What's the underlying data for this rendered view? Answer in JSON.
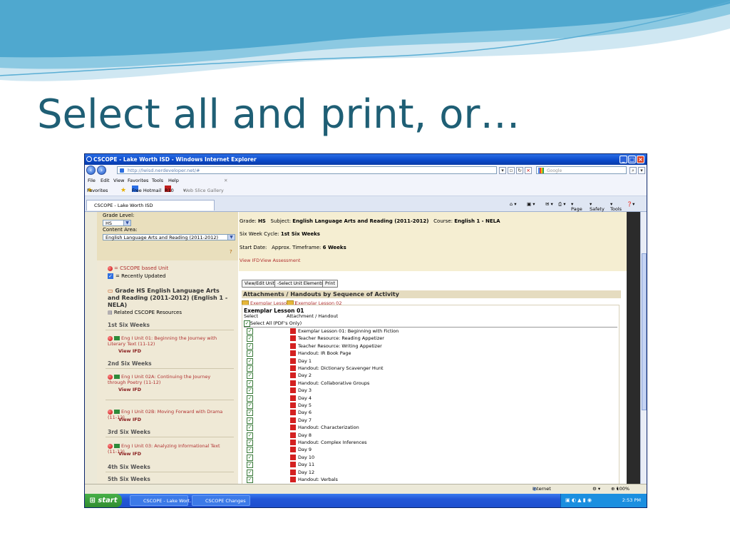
{
  "slide": {
    "title": "Select all and print, or…"
  },
  "window": {
    "title": "CSCOPE - Lake Worth ISD - Windows Internet Explorer",
    "address": "http://lwisd.nerdeveloper.net/#",
    "search_placeholder": "Google",
    "menu": [
      "File",
      "Edit",
      "View",
      "Favorites",
      "Tools",
      "Help"
    ],
    "favorites": {
      "label": "Favorites",
      "items": [
        "Free Hotmail",
        "R10",
        "Web Slice Gallery"
      ]
    },
    "tab_label": "CSCOPE - Lake Worth ISD",
    "tab_tools": [
      "Page",
      "Safety",
      "Tools"
    ]
  },
  "sidebar": {
    "grade_label": "Grade Level:",
    "grade_value": "HS",
    "content_label": "Content Area:",
    "content_value": "English Language Arts and Reading (2011-2012)",
    "help": "?",
    "legend_cscope": "= CSCOPE based Unit",
    "legend_updated": "= Recently Updated",
    "course_title": "Grade HS English Language Arts and Reading (2011-2012) (English 1 - NELA)",
    "related": "Related CSCOPE Resources",
    "weeks": [
      "1st Six Weeks",
      "2nd Six Weeks",
      "3rd Six Weeks",
      "4th Six Weeks",
      "5th Six Weeks"
    ],
    "units": [
      {
        "text": "Eng I Unit 01: Beginning the Journey with Literary Text (11-12)",
        "link": "View IFD"
      },
      {
        "text": "Eng I Unit 02A: Continuing the Journey through Poetry (11-12)",
        "link": "View IFD"
      },
      {
        "text": "Eng I Unit 02B: Moving Forward with Drama (11-12)",
        "link": "View IFD"
      },
      {
        "text": "Eng I Unit 03: Analyzing Informational Text (11-12)",
        "link": "View IFD"
      }
    ]
  },
  "main": {
    "grade_label": "Grade:",
    "grade": "HS",
    "subject_label": "Subject:",
    "subject": "English Language Arts and Reading (2011-2012)",
    "course_label": "Course:",
    "course": "English 1 - NELA",
    "cycle_label": "Six Week Cycle:",
    "cycle": "1st Six Weeks",
    "start_label": "Start Date:",
    "timeframe_label": "Approx. Timeframe:",
    "timeframe": "6 Weeks",
    "links": [
      "View IFD",
      "View Assessment"
    ],
    "buttons": [
      "View/Edit Unit",
      "-Select Unit Elements-",
      "Print"
    ],
    "section_title": "Attachments / Handouts by Sequence of Activity",
    "lesson_links": [
      "Exemplar Lesson 01",
      "Exemplar Lesson 02"
    ],
    "lesson_title": "Exemplar Lesson 01",
    "col_select": "Select",
    "col_attachment": "Attachment / Handout",
    "select_all": "Select All (PDF's Only)",
    "attachments": [
      "Exemplar Lesson 01: Beginning with Fiction",
      "Teacher Resource: Reading Appetizer",
      "Teacher Resource: Writing Appetizer",
      "Handout: IR Book Page",
      "Day 1",
      "Handout: Dictionary Scavenger Hunt",
      "Day 2",
      "Handout: Collaborative Groups",
      "Day 3",
      "Day 4",
      "Day 5",
      "Day 6",
      "Day 7",
      "Handout: Characterization",
      "Day 8",
      "Handout: Complex Inferences",
      "Day 9",
      "Day 10",
      "Day 11",
      "Day 12",
      "Handout: Verbals"
    ]
  },
  "status": {
    "zone": "Internet",
    "zoom": "100%"
  },
  "taskbar": {
    "start": "start",
    "buttons": [
      "CSCOPE - Lake Wort...",
      "CSCOPE Changes"
    ],
    "clock": "2:53 PM"
  }
}
